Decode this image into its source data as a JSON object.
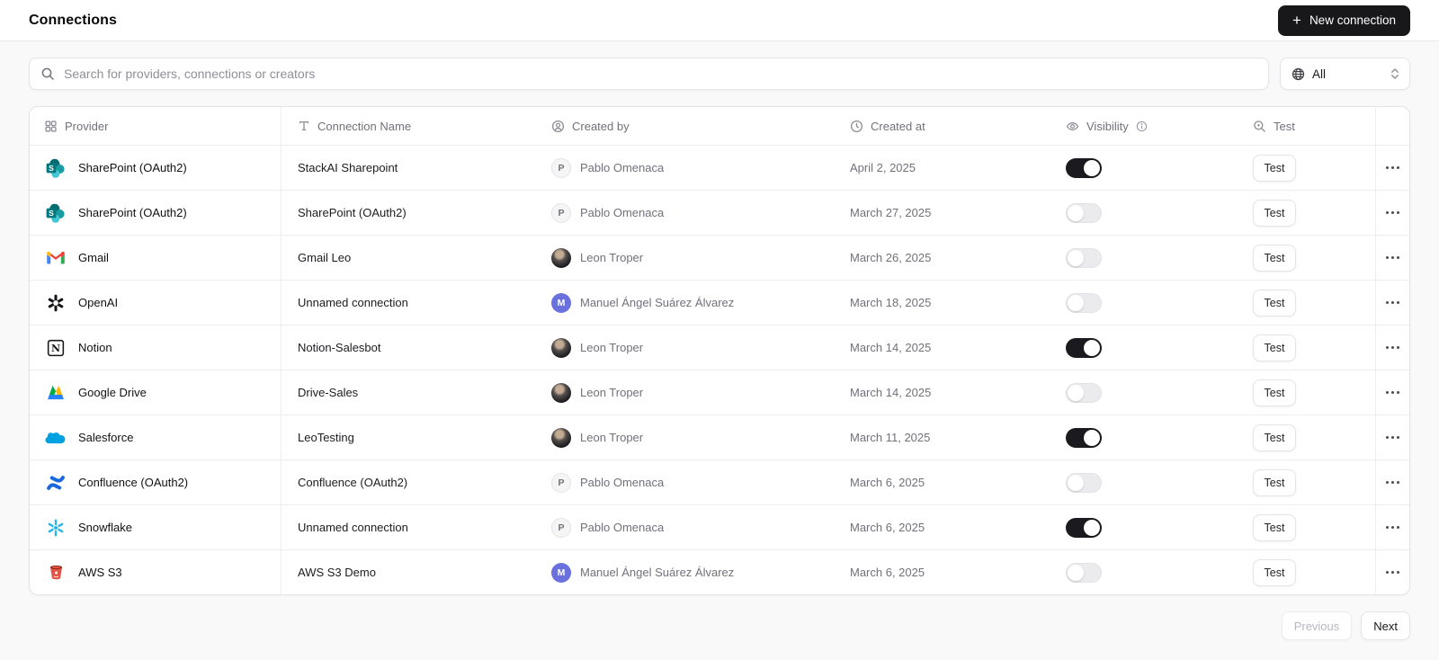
{
  "page": {
    "title": "Connections"
  },
  "header": {
    "new_connection_button": {
      "icon": "plus-icon",
      "icon_glyph": "+",
      "label": "New connection"
    }
  },
  "toolbar": {
    "search": {
      "icon": "search-icon",
      "placeholder": "Search for providers, connections or creators"
    },
    "provider_filter": {
      "icon": "globe-icon",
      "value": "All"
    }
  },
  "table": {
    "columns": [
      {
        "id": "provider",
        "icon": "grid-icon",
        "label": "Provider"
      },
      {
        "id": "connection_name",
        "icon": "text-icon",
        "label": "Connection Name"
      },
      {
        "id": "created_by",
        "icon": "user-circle-icon",
        "label": "Created by"
      },
      {
        "id": "created_at",
        "icon": "clock-icon",
        "label": "Created at"
      },
      {
        "id": "visibility",
        "icon": "eye-icon",
        "label": "Visibility",
        "info_icon": "info-icon"
      },
      {
        "id": "test",
        "icon": "search-check-icon",
        "label": "Test"
      }
    ],
    "row_action_label": "Test",
    "rows": [
      {
        "provider": "SharePoint (OAuth2)",
        "provider_icon": "sharepoint-icon",
        "connection_name": "StackAI Sharepoint",
        "created_by": {
          "name": "Pablo Omenaca",
          "avatar": {
            "type": "initial",
            "initial": "P",
            "style": "gray"
          }
        },
        "created_at": "April 2, 2025",
        "visibility_on": true
      },
      {
        "provider": "SharePoint (OAuth2)",
        "provider_icon": "sharepoint-icon",
        "connection_name": "SharePoint (OAuth2)",
        "created_by": {
          "name": "Pablo Omenaca",
          "avatar": {
            "type": "initial",
            "initial": "P",
            "style": "gray"
          }
        },
        "created_at": "March 27, 2025",
        "visibility_on": false
      },
      {
        "provider": "Gmail",
        "provider_icon": "gmail-icon",
        "connection_name": "Gmail Leo",
        "created_by": {
          "name": "Leon Troper",
          "avatar": {
            "type": "photo"
          }
        },
        "created_at": "March 26, 2025",
        "visibility_on": false
      },
      {
        "provider": "OpenAI",
        "provider_icon": "openai-icon",
        "connection_name": "Unnamed connection",
        "created_by": {
          "name": "Manuel Ángel Suárez Álvarez",
          "avatar": {
            "type": "initial",
            "initial": "M",
            "style": "indigo"
          }
        },
        "created_at": "March 18, 2025",
        "visibility_on": false
      },
      {
        "provider": "Notion",
        "provider_icon": "notion-icon",
        "connection_name": "Notion-Salesbot",
        "created_by": {
          "name": "Leon Troper",
          "avatar": {
            "type": "photo"
          }
        },
        "created_at": "March 14, 2025",
        "visibility_on": true
      },
      {
        "provider": "Google Drive",
        "provider_icon": "google-drive-icon",
        "connection_name": "Drive-Sales",
        "created_by": {
          "name": "Leon Troper",
          "avatar": {
            "type": "photo"
          }
        },
        "created_at": "March 14, 2025",
        "visibility_on": false
      },
      {
        "provider": "Salesforce",
        "provider_icon": "salesforce-icon",
        "connection_name": "LeoTesting",
        "created_by": {
          "name": "Leon Troper",
          "avatar": {
            "type": "photo"
          }
        },
        "created_at": "March 11, 2025",
        "visibility_on": true
      },
      {
        "provider": "Confluence (OAuth2)",
        "provider_icon": "confluence-icon",
        "connection_name": "Confluence (OAuth2)",
        "created_by": {
          "name": "Pablo Omenaca",
          "avatar": {
            "type": "initial",
            "initial": "P",
            "style": "gray"
          }
        },
        "created_at": "March 6, 2025",
        "visibility_on": false
      },
      {
        "provider": "Snowflake",
        "provider_icon": "snowflake-icon",
        "connection_name": "Unnamed connection",
        "created_by": {
          "name": "Pablo Omenaca",
          "avatar": {
            "type": "initial",
            "initial": "P",
            "style": "gray"
          }
        },
        "created_at": "March 6, 2025",
        "visibility_on": true
      },
      {
        "provider": "AWS S3",
        "provider_icon": "aws-s3-icon",
        "connection_name": "AWS S3 Demo",
        "created_by": {
          "name": "Manuel Ángel Suárez Álvarez",
          "avatar": {
            "type": "initial",
            "initial": "M",
            "style": "indigo"
          }
        },
        "created_at": "March 6, 2025",
        "visibility_on": false
      }
    ]
  },
  "pagination": {
    "previous_label": "Previous",
    "next_label": "Next",
    "previous_enabled": false
  },
  "colors": {
    "accent": "#18181b",
    "muted_text": "#71717a",
    "border": "#e4e4e7",
    "page_bg": "#f9f9fa",
    "toggle_on": "#1b1b1f",
    "toggle_off": "#ebebee",
    "avatar_indigo": "#6a71dc"
  }
}
